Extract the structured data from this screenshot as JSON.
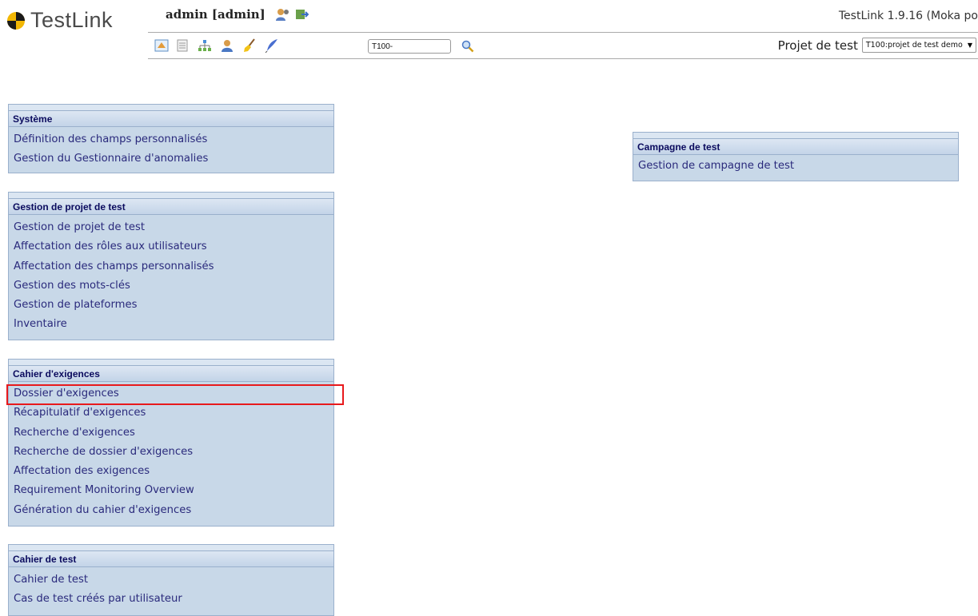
{
  "app": {
    "logo_text": "TestLink",
    "user_label": "admin [admin]",
    "version": "TestLink 1.9.16 (Moka po"
  },
  "toolbar": {
    "icons": [
      "desktop-icon",
      "specification-icon",
      "tree-icon",
      "user-icon",
      "broom-icon",
      "feather-icon"
    ],
    "search": {
      "value": "T100-"
    },
    "project_label": "Projet de test",
    "project_selected": "T100:projet de test demo"
  },
  "sections": {
    "systeme": {
      "title": "Système",
      "items": [
        "Définition des champs personnalisés",
        "Gestion du Gestionnaire d'anomalies"
      ]
    },
    "gestion_projet": {
      "title": "Gestion de projet de test",
      "items": [
        "Gestion de projet de test",
        "Affectation des rôles aux utilisateurs",
        "Affectation des champs personnalisés",
        "Gestion des mots-clés",
        "Gestion de plateformes",
        "Inventaire"
      ]
    },
    "cahier_exigences": {
      "title": "Cahier d'exigences",
      "items": [
        "Dossier d'exigences",
        "Récapitulatif d'exigences",
        "Recherche d'exigences",
        "Recherche de dossier d'exigences",
        "Affectation des exigences",
        "Requirement Monitoring Overview",
        "Génération du cahier d'exigences"
      ]
    },
    "cahier_test": {
      "title": "Cahier de test",
      "items": [
        "Cahier de test",
        "Cas de test créés par utilisateur"
      ]
    },
    "campagne": {
      "title": "Campagne de test",
      "items": [
        "Gestion de campagne de test"
      ]
    }
  },
  "colors": {
    "panel_bg": "#c8d8e8",
    "link_text": "#2a2a7c",
    "highlight": "#e8191c"
  }
}
